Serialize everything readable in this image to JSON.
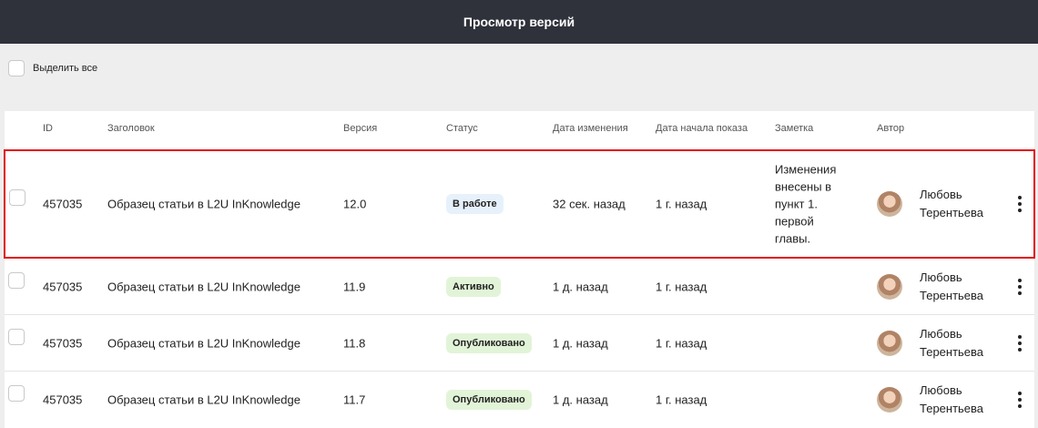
{
  "header": {
    "title": "Просмотр версий"
  },
  "select_all": {
    "label": "Выделить все"
  },
  "table": {
    "columns": {
      "id": "ID",
      "title": "Заголовок",
      "version": "Версия",
      "status": "Статус",
      "changed": "Дата изменения",
      "show_start": "Дата начала показа",
      "note": "Заметка",
      "author": "Автор"
    },
    "rows": [
      {
        "id": "457035",
        "title": "Образец статьи в L2U InKnowledge",
        "version": "12.0",
        "status": "В работе",
        "changed": "32 сек. назад",
        "show_start": "1 г. назад",
        "note": "Изменения внесены в пункт 1. первой главы.",
        "author": "Любовь Терентьева",
        "selected": true
      },
      {
        "id": "457035",
        "title": "Образец статьи в L2U InKnowledge",
        "version": "11.9",
        "status": "Активно",
        "changed": "1 д. назад",
        "show_start": "1 г. назад",
        "note": "",
        "author": "Любовь Терентьева"
      },
      {
        "id": "457035",
        "title": "Образец статьи в L2U InKnowledge",
        "version": "11.8",
        "status": "Опубликовано",
        "changed": "1 д. назад",
        "show_start": "1 г. назад",
        "note": "",
        "author": "Любовь Терентьева"
      },
      {
        "id": "457035",
        "title": "Образец статьи в L2U InKnowledge",
        "version": "11.7",
        "status": "Опубликовано",
        "changed": "1 д. назад",
        "show_start": "1 г. назад",
        "note": "",
        "author": "Любовь Терентьева"
      }
    ]
  },
  "colors": {
    "header_bg": "#2f323b",
    "selection_border": "#e10f0f",
    "status_work_bg": "#e6f1fb",
    "status_active_bg": "#e2f4d8"
  },
  "icons": {
    "row_menu": "more-vertical-icon",
    "author_avatar": "avatar"
  }
}
